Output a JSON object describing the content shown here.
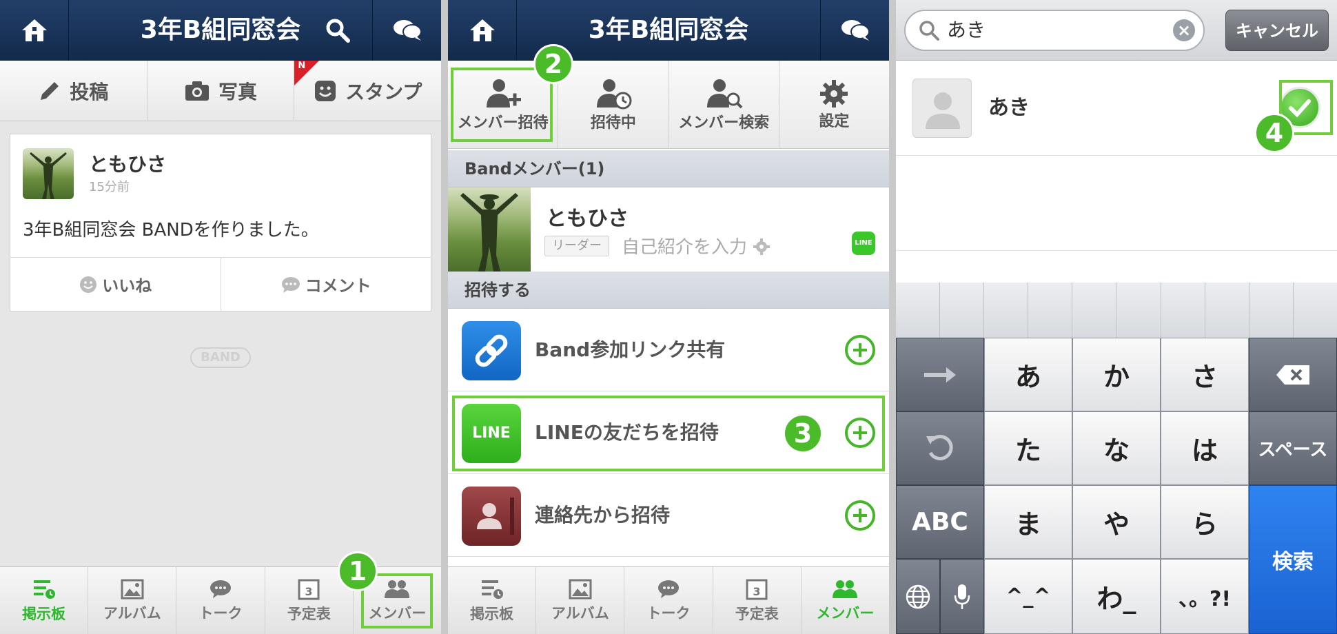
{
  "panel1": {
    "header": {
      "title": "3年B組同窓会"
    },
    "toolbar": [
      {
        "label": "投稿",
        "icon": "pencil-icon"
      },
      {
        "label": "写真",
        "icon": "camera-icon"
      },
      {
        "label": "スタンプ",
        "icon": "sticker-icon",
        "new_badge": "N"
      }
    ],
    "post": {
      "author": "ともひさ",
      "time": "15分前",
      "text": "3年B組同窓会 BANDを作りました。",
      "like": "いいね",
      "comment": "コメント"
    },
    "logo": "BAND",
    "nav": [
      {
        "label": "掲示板",
        "active": true
      },
      {
        "label": "アルバム",
        "active": false
      },
      {
        "label": "トーク",
        "active": false
      },
      {
        "label": "予定表",
        "calendar_day": "3",
        "active": false
      },
      {
        "label": "メンバー",
        "active": false
      }
    ],
    "step": "1"
  },
  "panel2": {
    "header": {
      "title": "3年B組同窓会"
    },
    "toolbar": [
      {
        "label": "メンバー招待"
      },
      {
        "label": "招待中"
      },
      {
        "label": "メンバー検索"
      },
      {
        "label": "設定"
      }
    ],
    "members_header": "Bandメンバー(1)",
    "member": {
      "name": "ともひさ",
      "role": "リーダー",
      "intro": "自己紹介を入力",
      "line_badge": "LINE"
    },
    "invite_header": "招待する",
    "invites": [
      {
        "label": "Band参加リンク共有"
      },
      {
        "label": "LINEの友だちを招待",
        "icon_text": "LINE"
      },
      {
        "label": "連絡先から招待"
      }
    ],
    "nav": [
      {
        "label": "掲示板",
        "active": false
      },
      {
        "label": "アルバム",
        "active": false
      },
      {
        "label": "トーク",
        "active": false
      },
      {
        "label": "予定表",
        "calendar_day": "3",
        "active": false
      },
      {
        "label": "メンバー",
        "active": true
      }
    ],
    "step2": "2",
    "step3": "3"
  },
  "panel3": {
    "search": {
      "value": "あき",
      "cancel": "キャンセル"
    },
    "result": {
      "name": "あき"
    },
    "keys": {
      "row1": [
        "あ",
        "か",
        "さ"
      ],
      "row2": [
        "た",
        "な",
        "は"
      ],
      "row3": [
        "ま",
        "や",
        "ら"
      ],
      "row4": [
        "^_^",
        "わ_",
        "、。?!"
      ],
      "abc": "ABC",
      "space": "スペース",
      "search": "検索"
    },
    "step": "4"
  },
  "colors": {
    "header": "#1a3459",
    "accent_green": "#4cbb2a",
    "keyboard_blue": "#1f6fe0"
  }
}
